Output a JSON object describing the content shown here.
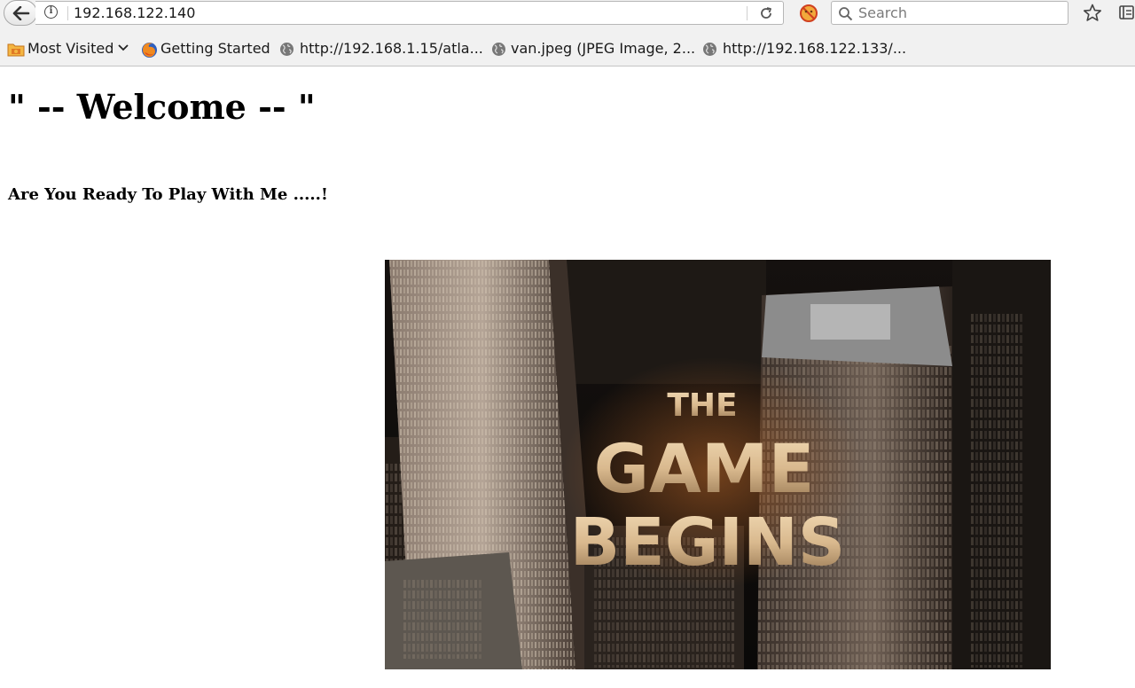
{
  "browser": {
    "url": "192.168.122.140",
    "search_placeholder": "Search",
    "bookmarks": [
      {
        "label": "Most Visited",
        "icon": "folder-icon"
      },
      {
        "label": "Getting Started",
        "icon": "firefox-icon"
      },
      {
        "label": "http://192.168.1.15/atla...",
        "icon": "globe-icon"
      },
      {
        "label": "van.jpeg (JPEG Image, 2...",
        "icon": "globe-icon"
      },
      {
        "label": "http://192.168.122.133/...",
        "icon": "globe-icon"
      }
    ]
  },
  "page": {
    "heading": "\" -- Welcome -- \"",
    "subheading": "Are You Ready To Play With Me .....!",
    "hero_image": {
      "line1": "THE",
      "line2": "GAME",
      "line3": "BEGINS"
    }
  },
  "colors": {
    "toolbar_bg": "#f1f1f1",
    "hero_text": "#d9b98e"
  }
}
